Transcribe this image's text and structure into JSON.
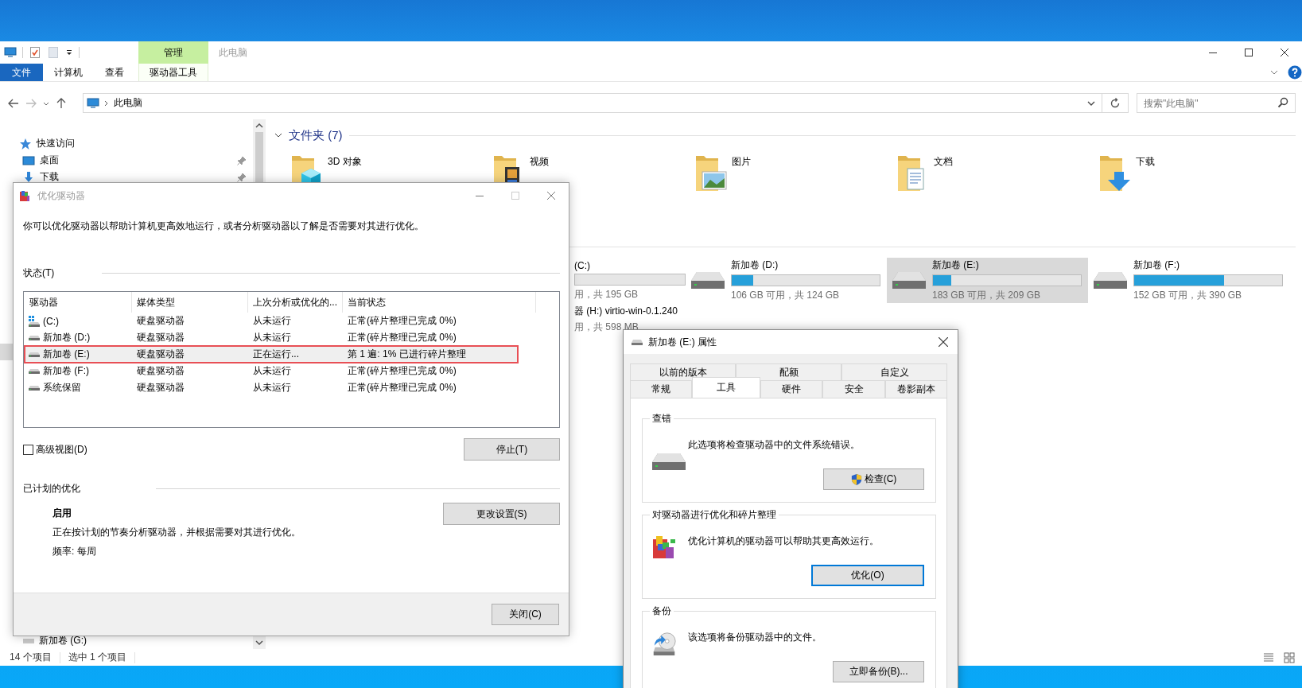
{
  "explorer": {
    "title": "此电脑",
    "ribbon": {
      "context_label": "管理",
      "tabs": [
        {
          "label": "文件",
          "kind": "file"
        },
        {
          "label": "计算机",
          "kind": "normal"
        },
        {
          "label": "查看",
          "kind": "normal"
        },
        {
          "label": "驱动器工具",
          "kind": "contextual"
        }
      ]
    },
    "address": {
      "path": "此电脑"
    },
    "search": {
      "placeholder": "搜索\"此电脑\""
    },
    "nav": {
      "items": [
        {
          "label": "快速访问",
          "kind": "quick-access",
          "pinned": false
        },
        {
          "label": "桌面",
          "kind": "desktop",
          "pinned": true
        },
        {
          "label": "下载",
          "kind": "downloads",
          "pinned": true
        }
      ],
      "bottom_item": {
        "label": "新加卷 (G:)"
      }
    },
    "folders": {
      "heading": "文件夹 (7)",
      "items": [
        {
          "name": "3D 对象",
          "kind": "cube"
        },
        {
          "name": "视频",
          "kind": "video"
        },
        {
          "name": "图片",
          "kind": "pictures"
        },
        {
          "name": "文档",
          "kind": "documents"
        },
        {
          "name": "下载",
          "kind": "downloads"
        }
      ]
    },
    "drives": [
      {
        "label": "(C:)",
        "space": "用，共 195 GB",
        "kind": "partial",
        "bar": true,
        "selected": false
      },
      {
        "label": "新加卷 (D:)",
        "space": "106 GB 可用，共 124 GB",
        "kind": "drive",
        "bar": true,
        "level": 0.145,
        "selected": false
      },
      {
        "label": "新加卷 (E:)",
        "space": "183 GB 可用，共 209 GB",
        "kind": "drive",
        "bar": true,
        "level": 0.124,
        "selected": true
      },
      {
        "label": "新加卷 (F:)",
        "space": "152 GB 可用，共 390 GB",
        "kind": "drive",
        "bar": true,
        "level": 0.61,
        "selected": false
      },
      {
        "label": "器 (H:) virtio-win-0.1.240",
        "space": "用，共 598 MB",
        "kind": "partial",
        "bar": false,
        "selected": false
      }
    ],
    "status_bar": {
      "count": "14 个项目",
      "selection": "选中 1 个项目"
    }
  },
  "optimize_dialog": {
    "title": "优化驱动器",
    "description": "你可以优化驱动器以帮助计算机更高效地运行，或者分析驱动器以了解是否需要对其进行优化。",
    "status_label": "状态(T)",
    "columns": [
      "驱动器",
      "媒体类型",
      "上次分析或优化的...",
      "当前状态"
    ],
    "rows": [
      {
        "drive": "(C:)",
        "kind": "system",
        "media": "硬盘驱动器",
        "last_run": "从未运行",
        "status": "正常(碎片整理已完成 0%)",
        "selected": false,
        "outlined": false
      },
      {
        "drive": "新加卷 (D:)",
        "kind": "drive",
        "media": "硬盘驱动器",
        "last_run": "从未运行",
        "status": "正常(碎片整理已完成 0%)",
        "selected": false,
        "outlined": false
      },
      {
        "drive": "新加卷 (E:)",
        "kind": "drive",
        "media": "硬盘驱动器",
        "last_run": "正在运行...",
        "status": "第 1 遍: 1% 已进行碎片整理",
        "selected": true,
        "outlined": true
      },
      {
        "drive": "新加卷 (F:)",
        "kind": "drive",
        "media": "硬盘驱动器",
        "last_run": "从未运行",
        "status": "正常(碎片整理已完成 0%)",
        "selected": false,
        "outlined": false
      },
      {
        "drive": "系统保留",
        "kind": "drive",
        "media": "硬盘驱动器",
        "last_run": "从未运行",
        "status": "正常(碎片整理已完成 0%)",
        "selected": false,
        "outlined": false
      }
    ],
    "advanced_view": {
      "label": "高级视图(D)",
      "checked": false
    },
    "stop_button": "停止(T)",
    "schedule": {
      "heading": "已计划的优化",
      "state": "启用",
      "description": "正在按计划的节奏分析驱动器，并根据需要对其进行优化。",
      "frequency": "频率: 每周",
      "button": "更改设置(S)"
    },
    "close_button": "关闭(C)"
  },
  "properties_dialog": {
    "title": "新加卷 (E:) 属性",
    "tab_rows": [
      [
        {
          "label": "以前的版本",
          "selected": false
        },
        {
          "label": "配额",
          "selected": false
        },
        {
          "label": "自定义",
          "selected": false
        }
      ],
      [
        {
          "label": "常规",
          "selected": false
        },
        {
          "label": "工具",
          "selected": true
        },
        {
          "label": "硬件",
          "selected": false
        },
        {
          "label": "安全",
          "selected": false
        },
        {
          "label": "卷影副本",
          "selected": false
        }
      ]
    ],
    "groups": [
      {
        "title": "查错",
        "text": "此选项将检查驱动器中的文件系统错误。",
        "button": "检查(C)",
        "kind": "check",
        "focused": false
      },
      {
        "title": "对驱动器进行优化和碎片整理",
        "text": "优化计算机的驱动器可以帮助其更高效运行。",
        "button": "优化(O)",
        "kind": "defrag",
        "focused": true
      },
      {
        "title": "备份",
        "text": "该选项将备份驱动器中的文件。",
        "button": "立即备份(B)...",
        "kind": "backup",
        "focused": false
      }
    ]
  }
}
